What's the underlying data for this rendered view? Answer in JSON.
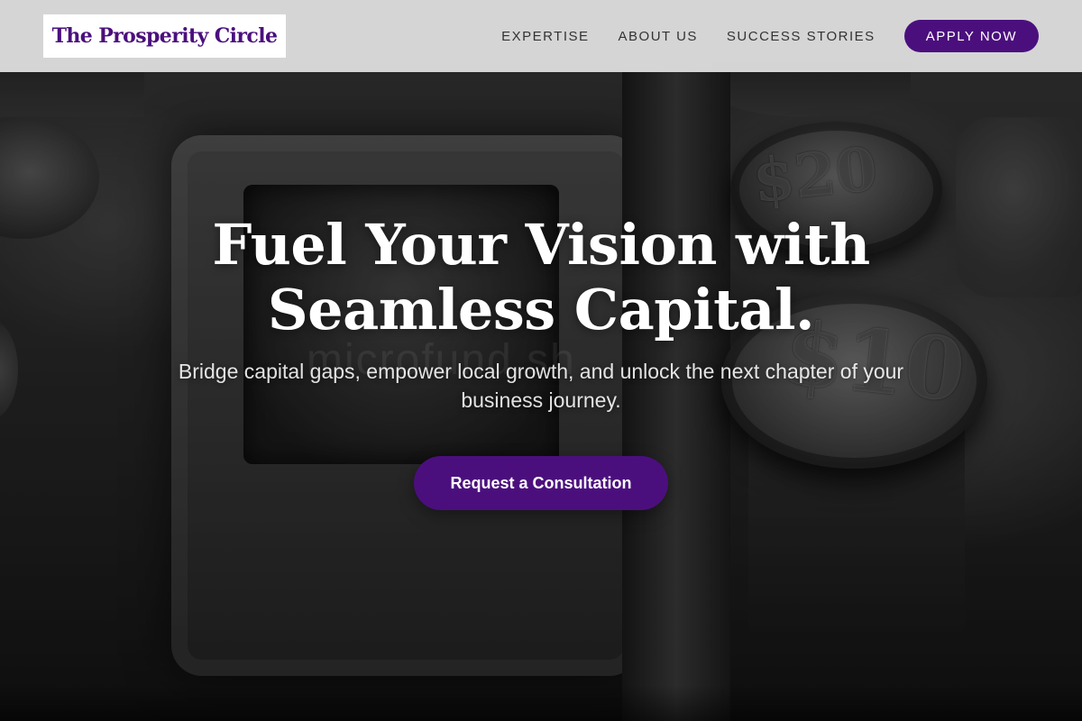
{
  "brand": {
    "name": "The Prosperity Circle",
    "accent_color": "#4b0f7d"
  },
  "nav": {
    "links": [
      "EXPERTISE",
      "ABOUT US",
      "SUCCESS STORIES"
    ],
    "cta_label": "APPLY NOW"
  },
  "hero": {
    "headline_line1": "Fuel Your Vision with",
    "headline_line2": "Seamless Capital.",
    "subtext": "Bridge capital gaps, empower local growth, and unlock the next chapter of your business journey.",
    "cta_label": "Request a Consultation",
    "background_image": {
      "key_labels": [
        "$20",
        "$10"
      ],
      "watermark_text": "microfund.sh"
    }
  }
}
